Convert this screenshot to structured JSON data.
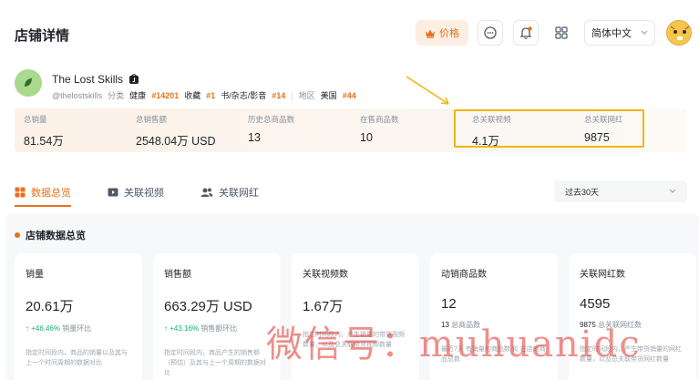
{
  "header": {
    "title": "店铺详情",
    "price_label": "价格",
    "language": "简体中文"
  },
  "shop": {
    "name": "The Lost Skills",
    "handle": "@thelostskills",
    "category_label": "分类",
    "category": "健康",
    "category_rank": "#14201",
    "collection_label": "收藏",
    "collection_rank": "#1",
    "books_label": "书/杂志/影音",
    "books_rank": "#14",
    "region_label": "地区",
    "region": "美国",
    "region_rank": "#44"
  },
  "stats": [
    {
      "label": "总销量",
      "value": "81.54万"
    },
    {
      "label": "总销售额",
      "value": "2548.04万 USD"
    },
    {
      "label": "历史总商品数",
      "value": "13"
    },
    {
      "label": "在售商品数",
      "value": "10"
    },
    {
      "label": "总关联视频",
      "value": "4.1万"
    },
    {
      "label": "总关联网红",
      "value": "9875"
    }
  ],
  "tabs": [
    {
      "label": "数据总览",
      "icon": "grid-icon"
    },
    {
      "label": "关联视频",
      "icon": "video-icon"
    },
    {
      "label": "关联网红",
      "icon": "users-icon"
    }
  ],
  "period": "过去30天",
  "overview": {
    "title": "店铺数据总览",
    "cards": [
      {
        "title": "销量",
        "value": "20.61万",
        "change": "↑ +46.46%",
        "change_label": "销量环比",
        "desc": "指定时间段内，商品的销量以及其与上一个时间周期的数据对比"
      },
      {
        "title": "销售额",
        "value": "663.29万 USD",
        "change": "↑ +43.16%",
        "change_label": "销售额环比",
        "desc": "指定时间段内，商品产生的销售额（预估）及其与上一个周期的数据对比"
      },
      {
        "title": "关联视频数",
        "value": "1.67万",
        "change": "",
        "change_label": "",
        "desc": "指定时间段内，产生销量的带货视频数量，以及总关联带货视频数量"
      },
      {
        "title": "动销商品数",
        "value": "12",
        "change": "13",
        "change_label": "总商品数",
        "desc": "最近7天 有销量的商品数 和 在店的商品总数"
      },
      {
        "title": "关联网红数",
        "value": "4595",
        "change": "9875",
        "change_label": "总关联网红数",
        "desc": "指定时间段内，产生带货销量的网红数量，以及总关联带货网红数量"
      }
    ]
  },
  "watermark": "微信号：muhuanidc",
  "colors": {
    "accent": "#e8711a",
    "positive": "#16b36e",
    "highlight": "#f2b511"
  }
}
